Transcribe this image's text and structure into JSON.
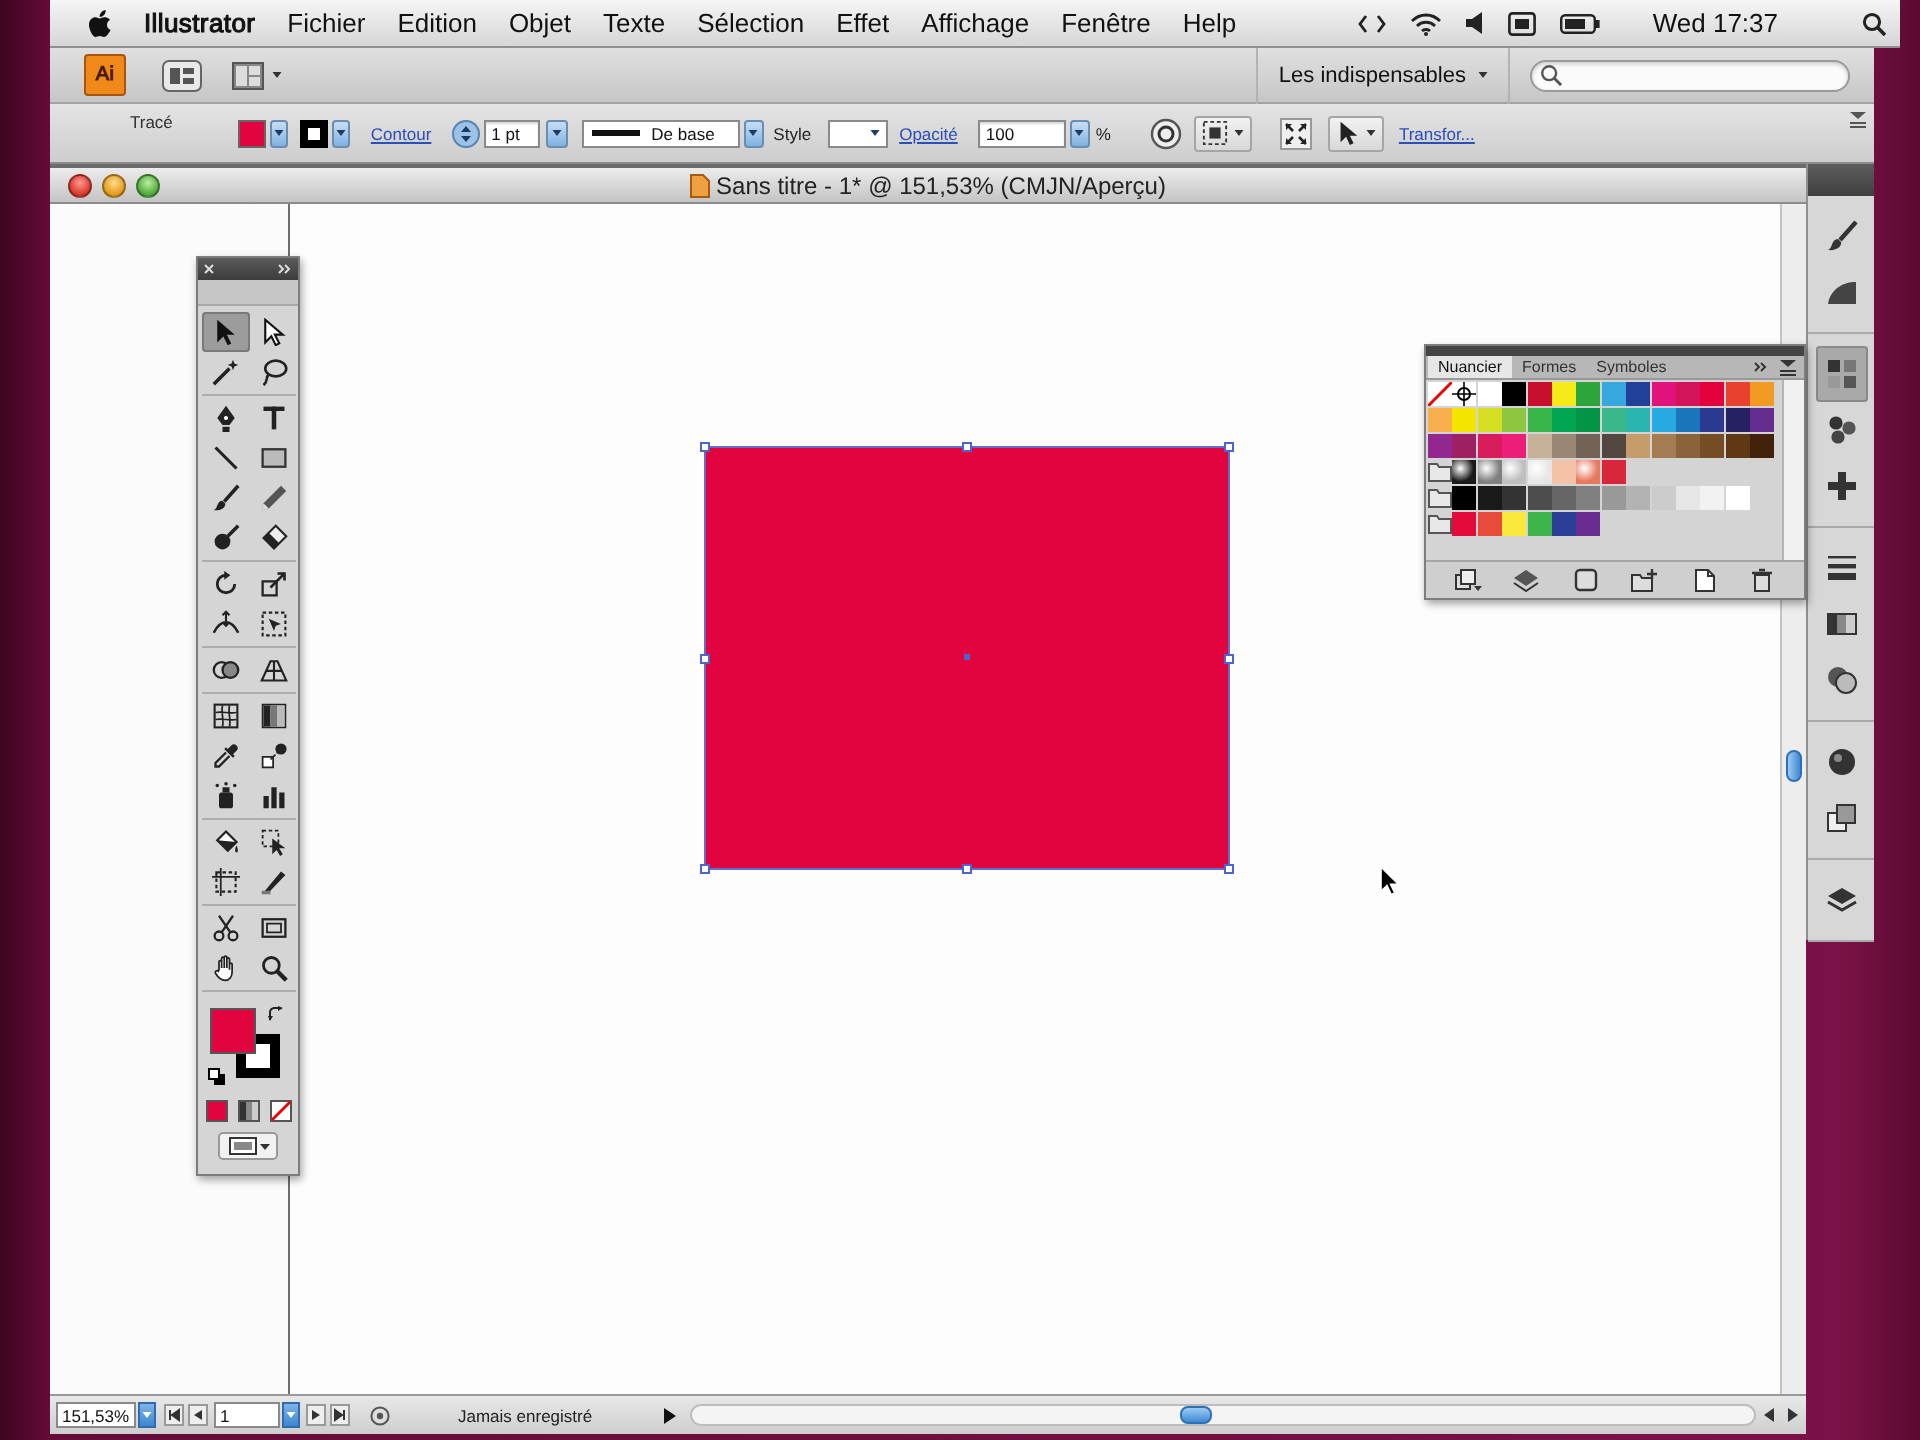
{
  "menu_bar": {
    "app_name": "Illustrator",
    "items": [
      "Fichier",
      "Edition",
      "Objet",
      "Texte",
      "Sélection",
      "Effet",
      "Affichage",
      "Fenêtre",
      "Help"
    ],
    "clock": "Wed 17:37"
  },
  "app_bar": {
    "logo": "Ai",
    "workspace": "Les indispensables"
  },
  "control_bar": {
    "label": "Tracé",
    "swatches": [
      {
        "kind": "fill",
        "color": "#e2043e"
      },
      {
        "kind": "stroke",
        "color": "#000000"
      }
    ],
    "stroke_link": "Contour",
    "stroke_weight": "1 pt",
    "profile": "De base",
    "style_label": "Style",
    "opacity_link": "Opacité",
    "opacity": "100",
    "opacity_unit": "%",
    "transform_link": "Transfor..."
  },
  "document": {
    "title": "Sans titre - 1* @ 151,53% (CMJN/Aperçu)"
  },
  "tools": {
    "groups": [
      {
        "items": [
          {
            "selected": true
          },
          {
            "selected": false
          },
          {
            "selected": false
          },
          {
            "selected": false
          }
        ]
      },
      {
        "items": [
          {
            "selected": false
          },
          {
            "selected": false
          },
          {
            "selected": false
          },
          {
            "selected": false
          },
          {
            "selected": false
          },
          {
            "selected": false
          },
          {
            "selected": false
          },
          {
            "selected": false
          }
        ]
      },
      {
        "items": [
          {
            "selected": false
          },
          {
            "selected": false
          },
          {
            "selected": false
          },
          {
            "selected": false
          }
        ]
      },
      {
        "items": [
          {
            "selected": false
          },
          {
            "selected": false
          }
        ]
      },
      {
        "items": [
          {
            "selected": false
          },
          {
            "selected": false
          },
          {
            "selected": false
          },
          {
            "selected": false
          },
          {
            "selected": false
          },
          {
            "selected": false
          }
        ]
      },
      {
        "items": [
          {
            "selected": false
          },
          {
            "selected": false
          },
          {
            "selected": false
          },
          {
            "selected": false
          }
        ]
      },
      {
        "items": [
          {
            "selected": false
          },
          {
            "selected": false
          },
          {
            "selected": false
          },
          {
            "selected": false
          }
        ]
      }
    ],
    "indicators": [
      {
        "kind": "fill",
        "color": "#e2043e"
      },
      {
        "kind": "stroke",
        "color": "#000000"
      }
    ]
  },
  "artwork": {
    "rectangle": {
      "color": "#e2043e",
      "selected": true
    }
  },
  "swatches_panel": {
    "tabs": [
      {
        "label": "Nuancier",
        "selected": true
      },
      {
        "label": "Formes",
        "selected": false
      },
      {
        "label": "Symboles",
        "selected": false
      }
    ],
    "rows": [
      {
        "group": false,
        "swatches": [
          {
            "kind": "none"
          },
          {
            "kind": "registration"
          },
          {
            "kind": "color",
            "color": "#ffffff"
          },
          {
            "kind": "color",
            "color": "#000000"
          },
          {
            "kind": "color",
            "color": "#c8102e"
          },
          {
            "kind": "color",
            "color": "#f6eb16"
          },
          {
            "kind": "color",
            "color": "#2ca53a"
          },
          {
            "kind": "color",
            "color": "#34a8df"
          },
          {
            "kind": "color",
            "color": "#21409a"
          },
          {
            "kind": "color",
            "color": "#e2127c"
          },
          {
            "kind": "color",
            "color": "#d4145a"
          },
          {
            "kind": "color",
            "color": "#e4003b"
          },
          {
            "kind": "color",
            "color": "#e8412f"
          },
          {
            "kind": "color",
            "color": "#f39a25"
          }
        ]
      },
      {
        "group": false,
        "swatches": [
          {
            "kind": "color",
            "color": "#f8b04f"
          },
          {
            "kind": "color",
            "color": "#f3e500"
          },
          {
            "kind": "color",
            "color": "#d7df23"
          },
          {
            "kind": "color",
            "color": "#8dc63f"
          },
          {
            "kind": "color",
            "color": "#39b54a"
          },
          {
            "kind": "color",
            "color": "#00a651"
          },
          {
            "kind": "color",
            "color": "#009444"
          },
          {
            "kind": "color",
            "color": "#3ab88b"
          },
          {
            "kind": "color",
            "color": "#2bb5b0"
          },
          {
            "kind": "color",
            "color": "#27aae1"
          },
          {
            "kind": "color",
            "color": "#1b75bb"
          },
          {
            "kind": "color",
            "color": "#2b3990"
          },
          {
            "kind": "color",
            "color": "#262262"
          },
          {
            "kind": "color",
            "color": "#662d91"
          }
        ]
      },
      {
        "group": false,
        "swatches": [
          {
            "kind": "color",
            "color": "#92278f"
          },
          {
            "kind": "color",
            "color": "#9e1f63"
          },
          {
            "kind": "color",
            "color": "#d91c5c"
          },
          {
            "kind": "color",
            "color": "#ed1e79"
          },
          {
            "kind": "color",
            "color": "#c7b299"
          },
          {
            "kind": "color",
            "color": "#998675"
          },
          {
            "kind": "color",
            "color": "#736357"
          },
          {
            "kind": "color",
            "color": "#534741"
          },
          {
            "kind": "color",
            "color": "#c69c6d"
          },
          {
            "kind": "color",
            "color": "#a67c52"
          },
          {
            "kind": "color",
            "color": "#8c6239"
          },
          {
            "kind": "color",
            "color": "#754c24"
          },
          {
            "kind": "color",
            "color": "#603813"
          },
          {
            "kind": "color",
            "color": "#42210b"
          }
        ]
      },
      {
        "group": true,
        "swatches": [
          {
            "kind": "gradient",
            "color": "#1a1a1a"
          },
          {
            "kind": "gradient",
            "color": "#808080"
          },
          {
            "kind": "gradient",
            "color": "#bfbfbf"
          },
          {
            "kind": "gradient",
            "color": "#e6e6e6"
          },
          {
            "kind": "color",
            "color": "#f4c2a6"
          },
          {
            "kind": "gradient",
            "color": "#e8785e"
          },
          {
            "kind": "color",
            "color": "#d8263a"
          }
        ]
      },
      {
        "group": true,
        "swatches": [
          {
            "kind": "color",
            "color": "#000000"
          },
          {
            "kind": "color",
            "color": "#1a1a1a"
          },
          {
            "kind": "color",
            "color": "#333333"
          },
          {
            "kind": "color",
            "color": "#4d4d4d"
          },
          {
            "kind": "color",
            "color": "#666666"
          },
          {
            "kind": "color",
            "color": "#808080"
          },
          {
            "kind": "color",
            "color": "#999999"
          },
          {
            "kind": "color",
            "color": "#b3b3b3"
          },
          {
            "kind": "color",
            "color": "#cccccc"
          },
          {
            "kind": "color",
            "color": "#e6e6e6"
          },
          {
            "kind": "color",
            "color": "#f2f2f2"
          },
          {
            "kind": "color",
            "color": "#ffffff"
          }
        ]
      },
      {
        "group": true,
        "swatches": [
          {
            "kind": "color",
            "color": "#e30b3c"
          },
          {
            "kind": "color",
            "color": "#e84a3c"
          },
          {
            "kind": "color",
            "color": "#fce83a"
          },
          {
            "kind": "color",
            "color": "#3db54a"
          },
          {
            "kind": "color",
            "color": "#2b3f98"
          },
          {
            "kind": "color",
            "color": "#6a2c90"
          }
        ]
      }
    ]
  },
  "dock": {
    "groups": [
      {
        "items": [
          {
            "selected": false
          },
          {
            "selected": false
          }
        ]
      },
      {
        "items": [
          {
            "selected": true
          },
          {
            "selected": false
          },
          {
            "selected": false
          }
        ]
      },
      {
        "items": [
          {
            "selected": false
          },
          {
            "selected": false
          },
          {
            "selected": false
          }
        ]
      },
      {
        "items": [
          {
            "selected": false
          },
          {
            "selected": false
          }
        ]
      },
      {
        "items": [
          {
            "selected": false
          }
        ]
      }
    ]
  },
  "status_bar": {
    "zoom": "151,53%",
    "page": "1",
    "status": "Jamais enregistré"
  }
}
